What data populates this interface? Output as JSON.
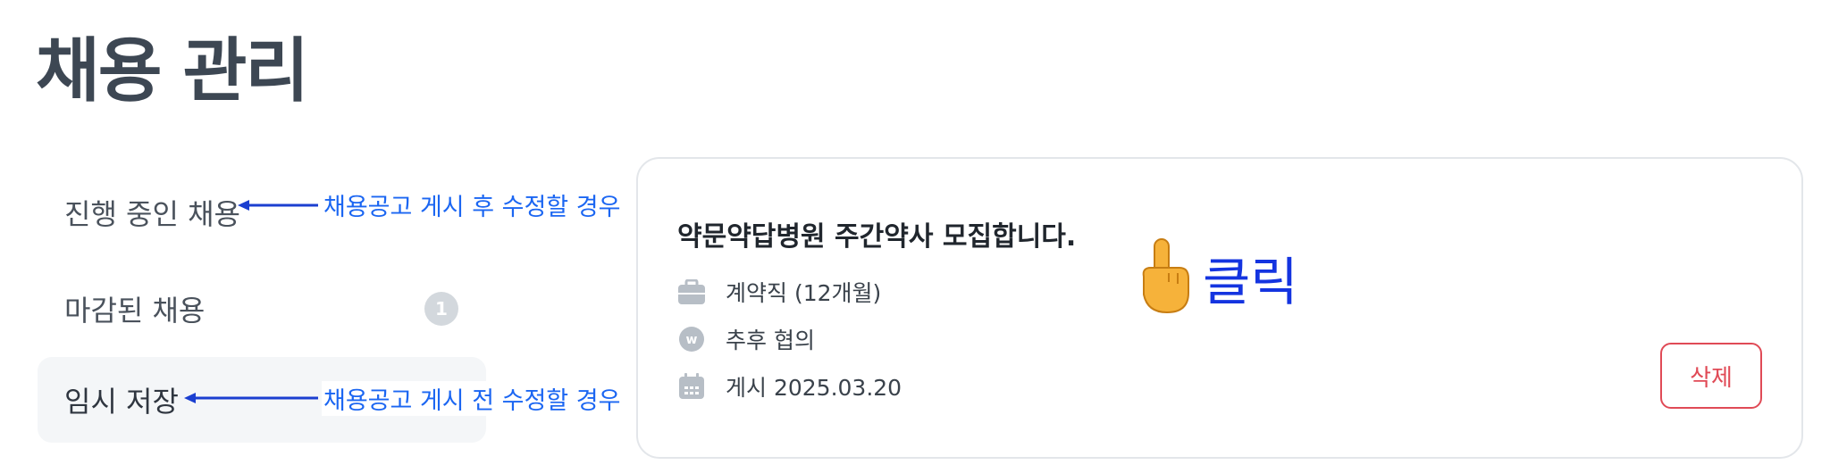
{
  "page": {
    "title": "채용 관리"
  },
  "sidebar": {
    "items": [
      {
        "label": "진행 중인 채용",
        "active": false
      },
      {
        "label": "마감된 채용",
        "count": "1",
        "active": false
      },
      {
        "label": "임시 저장",
        "active": true
      }
    ]
  },
  "annotations": {
    "in_progress_note": "채용공고 게시 후 수정할 경우",
    "draft_note": "채용공고 게시 전 수정할 경우",
    "click_hint": "클릭",
    "click_hint_icon": "pointing-hand-icon",
    "annotation_color": "#1b66f2"
  },
  "job_card": {
    "title": "약문약답병원 주간약사 모집합니다.",
    "employment_type": "계약직 (12개월)",
    "salary": "추후 협의",
    "posted": "게시 2025.03.20",
    "icons": [
      "briefcase-icon",
      "won-icon",
      "calendar-icon"
    ],
    "delete_label": "삭제",
    "delete_color": "#e04a56"
  }
}
